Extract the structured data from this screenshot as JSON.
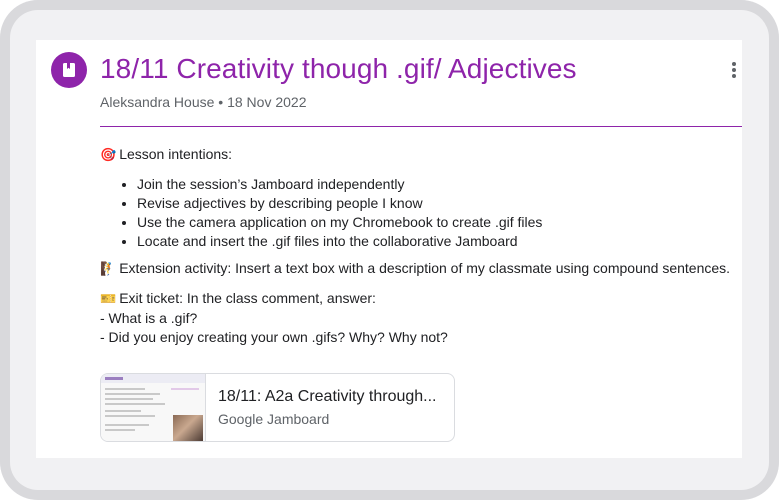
{
  "post": {
    "icon": "assignment-bookmark-icon",
    "title": "18/11 Creativity though .gif/ Adjectives",
    "author": "Aleksandra House",
    "separator": "•",
    "date": "18 Nov 2022",
    "accent_color": "#8e24aa"
  },
  "description": {
    "intentions_emoji": "🎯",
    "intentions_heading": "Lesson intentions:",
    "intentions": [
      "Join the session’s Jamboard independently",
      "Revise adjectives by describing people I know",
      "Use the camera application on my Chromebook to create .gif files",
      "Locate and insert the .gif files into the collaborative Jamboard"
    ],
    "extension_emoji": "🧗",
    "extension_text": "Extension activity:  Insert a text box with a description of my classmate using compound sentences.",
    "exit_emoji": "🎫",
    "exit_heading": "Exit ticket: In the class comment, answer:",
    "exit_questions": [
      "- What is a .gif?",
      "- Did you enjoy creating your own .gifs? Why? Why not?"
    ]
  },
  "attachment": {
    "title": "18/11: A2a Creativity through...",
    "source": "Google Jamboard"
  }
}
